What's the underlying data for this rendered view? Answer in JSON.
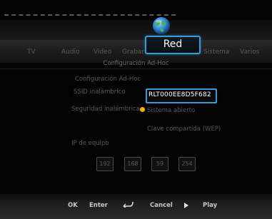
{
  "menu": {
    "items": [
      "TV",
      "Audio",
      "Video",
      "Grabar",
      "Red",
      "Sistema",
      "Varios"
    ],
    "selected": "Red"
  },
  "panel": {
    "subtitle": "Configuración Ad-Hoc",
    "heading": "Configuración Ad-Hoc",
    "ssid_label": "SSID inalámbrico",
    "ssid_value": "RLT000EE8D5F682",
    "security_label": "Seguridad inalámbrica",
    "security_option_open": "Sistema abierto",
    "security_option_wep": "Clave compartida (WEP)",
    "ip_label": "IP de equipo",
    "ip": [
      "192",
      "168",
      "59",
      "254"
    ]
  },
  "footer": {
    "ok_key": "OK",
    "ok_action": "Enter",
    "back_action": "Cancel",
    "play_action": "Play"
  },
  "colors": {
    "accent": "#3a9ad8",
    "radio": "#f0b400"
  },
  "icons": {
    "globe": "globe-icon",
    "return": "return-icon",
    "play": "play-icon"
  }
}
